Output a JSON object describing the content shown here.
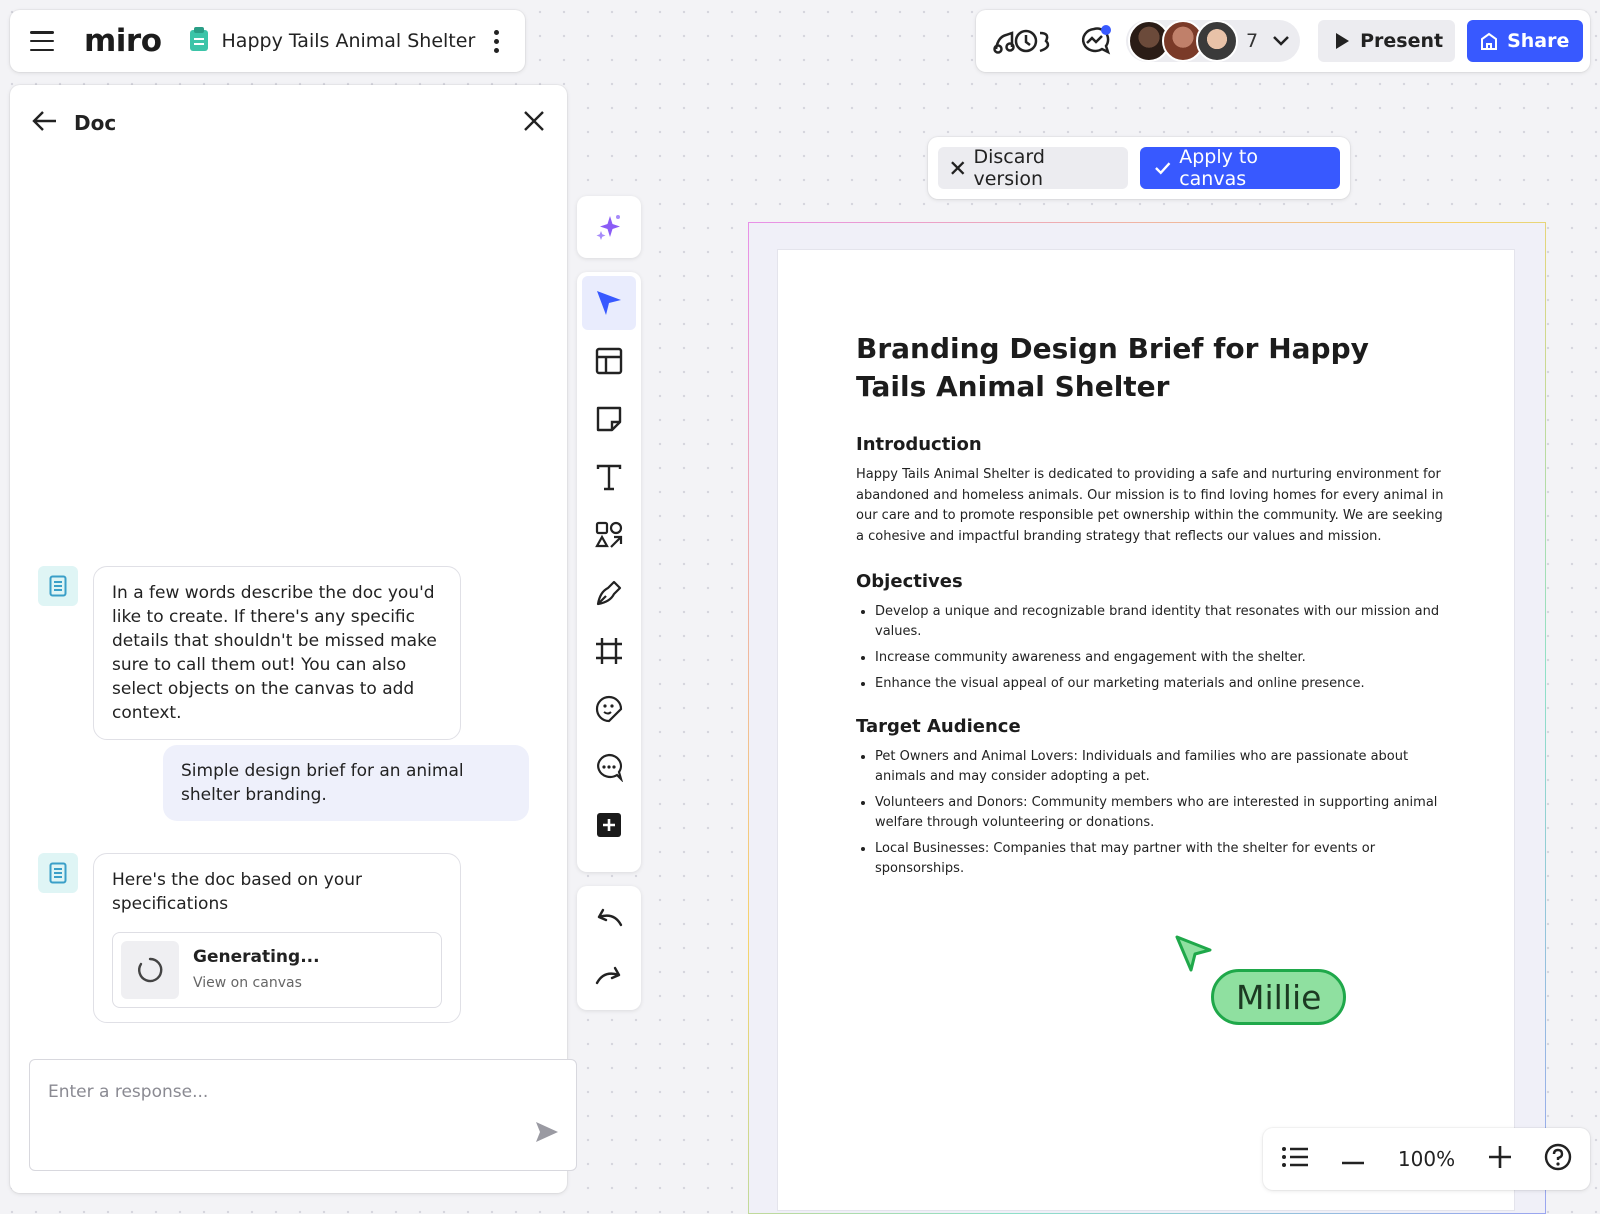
{
  "header": {
    "logo": "miro",
    "board_title": "Happy Tails Animal Shelter",
    "collaborator_count": "7",
    "present_label": "Present",
    "share_label": "Share"
  },
  "panel": {
    "title": "Doc",
    "messages": [
      {
        "role": "assistant",
        "text": "In a few words describe the doc you'd like to create. If there's any specific details that shouldn't be missed make sure to call them out! You can also select objects on the canvas to add context."
      },
      {
        "role": "user",
        "text": "Simple design brief for an animal shelter branding."
      },
      {
        "role": "assistant",
        "text": "Here's the doc based on your specifications"
      }
    ],
    "generating": {
      "title": "Generating...",
      "link": "View on canvas"
    },
    "reply_placeholder": "Enter a response..."
  },
  "version_bar": {
    "discard_label": "Discard version",
    "apply_label": "Apply to canvas"
  },
  "doc": {
    "title": "Branding Design Brief for Happy Tails Animal Shelter",
    "intro_heading": "Introduction",
    "intro_text": "Happy Tails Animal Shelter is dedicated to providing a safe and nurturing environment for abandoned and homeless animals. Our mission is to find loving homes for every animal in our care and to promote responsible pet ownership within the community. We are seeking a cohesive and impactful branding strategy that reflects our values and mission.",
    "objectives_heading": "Objectives",
    "objectives": [
      "Develop a unique and recognizable brand identity that resonates with our mission and values.",
      "Increase community awareness and engagement with the shelter.",
      "Enhance the visual appeal of our marketing materials and online presence."
    ],
    "audience_heading": "Target Audience",
    "audience": [
      "Pet Owners and Animal Lovers: Individuals and families who are passionate about animals and may consider adopting a pet.",
      "Volunteers and Donors: Community members who are interested in supporting animal welfare through volunteering or donations.",
      "Local Businesses: Companies that may partner with the shelter for events or sponsorships."
    ]
  },
  "cursor": {
    "name": "Millie"
  },
  "zoom": {
    "level": "100%"
  },
  "colors": {
    "accent": "#3859ff",
    "cursor_fill": "#8fe0a0",
    "cursor_border": "#1fa84a"
  }
}
